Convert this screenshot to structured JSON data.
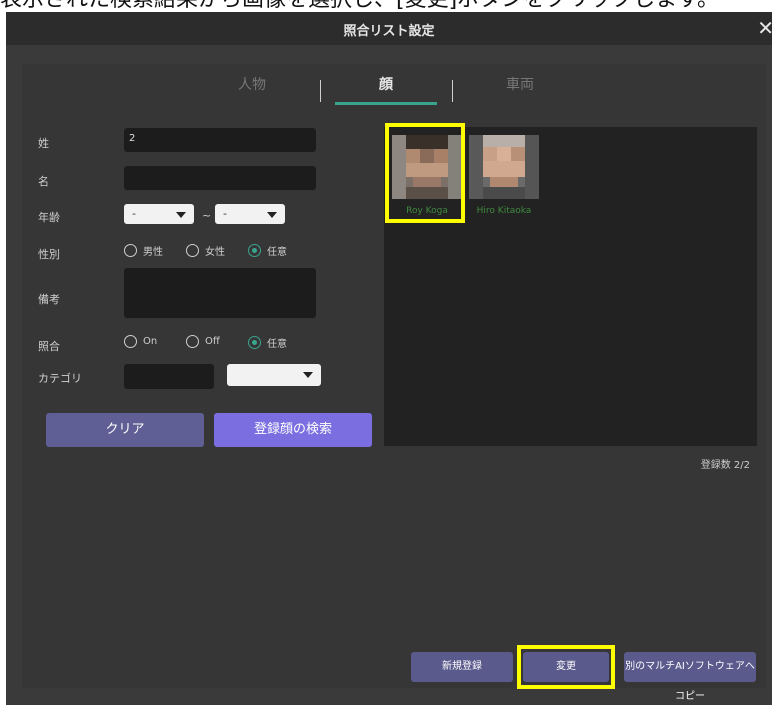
{
  "caption": "表示された検索結果から画像を選択し、[変更]ボタンをクリックします。",
  "dialog": {
    "title": "照合リスト設定",
    "close_glyph": "✕"
  },
  "tabs": [
    "人物",
    "顔",
    "車両"
  ],
  "form": {
    "last_name_label": "姓",
    "last_name_value": "2",
    "first_name_label": "名",
    "first_name_value": "",
    "age_label": "年齢",
    "age_from": "-",
    "age_to": "-",
    "age_tilde": "~",
    "gender_label": "性別",
    "gender_options": [
      "男性",
      "女性",
      "任意"
    ],
    "gender_selected": "任意",
    "note_label": "備考",
    "note_value": "",
    "match_label": "照合",
    "match_options": [
      "On",
      "Off",
      "任意"
    ],
    "match_selected": "任意",
    "category_label": "カテゴリ",
    "category_value": "",
    "category_select": ""
  },
  "buttons": {
    "clear": "クリア",
    "search": "登録顔の検索"
  },
  "results": [
    {
      "name": "Roy Koga",
      "selected": true
    },
    {
      "name": "Hiro Kitaoka",
      "selected": false
    }
  ],
  "count_text": "登録数 2/2",
  "footer": {
    "new": "新規登録",
    "change": "変更",
    "copy": "別のマルチAIソフトウェアへコピー"
  },
  "colors": {
    "accent": "#3aa58f",
    "highlight": "#ffff00",
    "button": "#5f5f95",
    "button_primary": "#7a6ee0"
  }
}
